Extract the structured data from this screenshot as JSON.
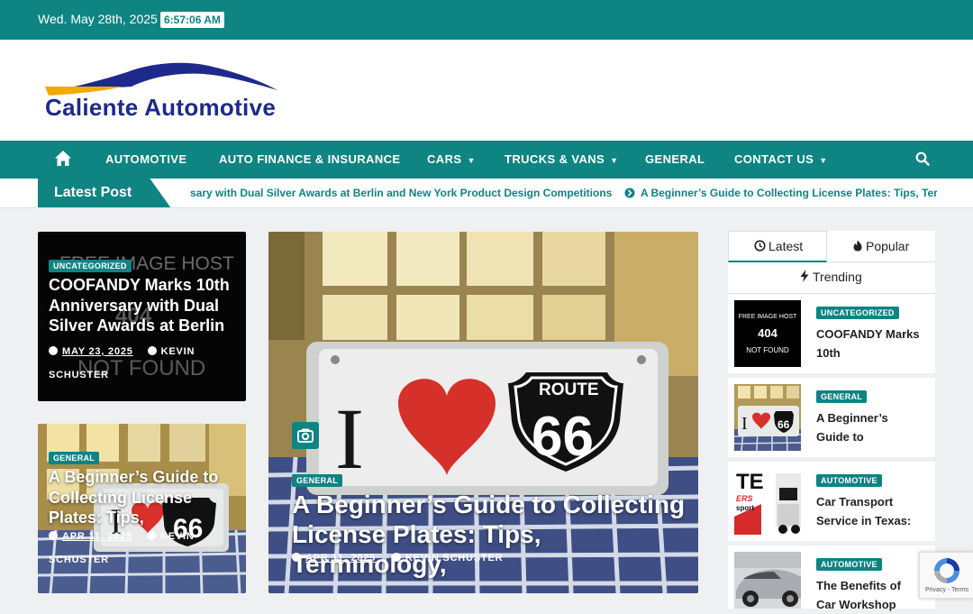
{
  "topbar": {
    "date": "Wed. May 28th, 2025",
    "time": "6:57:06 AM"
  },
  "site": {
    "name": "Caliente Automotive"
  },
  "nav": {
    "items": [
      {
        "label": "AUTOMOTIVE",
        "dropdown": false
      },
      {
        "label": "AUTO FINANCE & INSURANCE",
        "dropdown": false
      },
      {
        "label": "CARS",
        "dropdown": true
      },
      {
        "label": "TRUCKS & VANS",
        "dropdown": true
      },
      {
        "label": "GENERAL",
        "dropdown": false
      },
      {
        "label": "CONTACT US",
        "dropdown": true
      }
    ],
    "home_icon": "home-icon",
    "search_icon": "search-icon"
  },
  "ticker": {
    "label": "Latest Post",
    "items": [
      "sary with Dual Silver Awards at Berlin and New York Product Design Competitions",
      "A Beginner’s Guide to Collecting License Plates: Tips, Terr"
    ]
  },
  "cards": {
    "card1": {
      "category": "UNCATEGORIZED",
      "title": "COOFANDY Marks 10th Anniversary with Dual Silver Awards at Berlin",
      "date": "MAY 23, 2025",
      "author": "KEVIN SCHUSTER",
      "image_text_top": "FREE IMAGE HOST",
      "image_text_mid": "404",
      "image_text_bottom": "NOT FOUND"
    },
    "card2": {
      "category": "GENERAL",
      "title": "A Beginner’s Guide to Collecting License Plates: Tips,",
      "date": "APR 11, 2025",
      "author": "KEVIN SCHUSTER"
    },
    "featured": {
      "category": "GENERAL",
      "title": "A Beginner’s Guide to Collecting License Plates: Tips, Terminology,",
      "date": "APR 11, 2025",
      "author": "KEVIN SCHUSTER",
      "plate_left": "I",
      "shield_top": "ROUTE",
      "shield_num": "66"
    }
  },
  "sidebar": {
    "tabs": [
      {
        "label": "Latest",
        "icon": "clock-icon",
        "active": true
      },
      {
        "label": "Popular",
        "icon": "fire-icon",
        "active": false
      },
      {
        "label": "Trending",
        "icon": "bolt-icon",
        "active": false
      }
    ],
    "items": [
      {
        "category": "UNCATEGORIZED",
        "title": "COOFANDY Marks 10th",
        "thumb_top": "FREE IMAGE HOST",
        "thumb_mid": "404",
        "thumb_bottom": "NOT FOUND"
      },
      {
        "category": "GENERAL",
        "title": "A Beginner’s Guide to",
        "thumb_left": "I",
        "thumb_num": "66"
      },
      {
        "category": "AUTOMOTIVE",
        "title": "Car Transport Service in Texas:",
        "thumb_text": "TE",
        "thumb_sub": "ERS",
        "thumb_sub2": "sport"
      },
      {
        "category": "AUTOMOTIVE",
        "title": "The Benefits of Car Workshop"
      }
    ]
  },
  "recaptcha": {
    "text": "Privacy - Terms"
  },
  "colors": {
    "accent": "#0e8483",
    "brand_navy": "#1d2a8c",
    "brand_orange": "#f2a900"
  }
}
